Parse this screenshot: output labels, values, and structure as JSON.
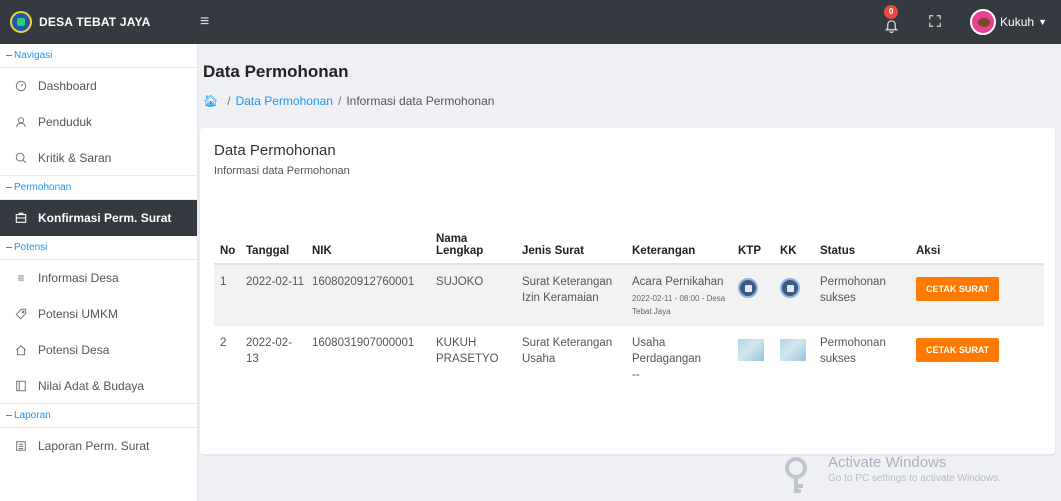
{
  "app": {
    "brand": "DESA TEBAT JAYA",
    "notification_count": "0",
    "user_name": "Kukuh"
  },
  "sidebar": {
    "sections": [
      {
        "header": "Navigasi",
        "items": [
          {
            "label": "Dashboard",
            "icon": "dashboard-icon"
          },
          {
            "label": "Penduduk",
            "icon": "user-icon"
          },
          {
            "label": "Kritik & Saran",
            "icon": "comment-icon"
          }
        ]
      },
      {
        "header": "Permohonan",
        "items": [
          {
            "label": "Konfirmasi Perm. Surat",
            "icon": "inbox-icon",
            "active": true
          }
        ]
      },
      {
        "header": "Potensi",
        "items": [
          {
            "label": "Informasi Desa",
            "icon": "list-icon"
          },
          {
            "label": "Potensi UMKM",
            "icon": "tag-icon"
          },
          {
            "label": "Potensi Desa",
            "icon": "home-icon"
          },
          {
            "label": "Nilai Adat & Budaya",
            "icon": "book-icon"
          }
        ]
      },
      {
        "header": "Laporan",
        "items": [
          {
            "label": "Laporan Perm. Surat",
            "icon": "report-icon"
          }
        ]
      }
    ]
  },
  "page": {
    "title": "Data Permohonan",
    "breadcrumb": {
      "link": "Data Permohonan",
      "sep": "/",
      "current": "Informasi data Permohonan"
    }
  },
  "card": {
    "title": "Data Permohonan",
    "subtitle": "Informasi data Permohonan",
    "columns": [
      "No",
      "Tanggal",
      "NIK",
      "Nama Lengkap",
      "Jenis Surat",
      "Keterangan",
      "KTP",
      "KK",
      "Status",
      "Aksi"
    ],
    "rows": [
      {
        "no": "1",
        "tanggal": "2022-02-11",
        "nik": "1608020912760001",
        "nama": "SUJOKO",
        "jenis": "Surat Keterangan Izin Keramaian",
        "keterangan": "Acara Pernikahan",
        "keterangan_detail": "2022-02-11 - 08:00 - Desa Tebat Jaya",
        "status": "Permohonan sukses",
        "aksi": "CETAK SURAT"
      },
      {
        "no": "2",
        "tanggal": "2022-02-13",
        "nik": "1608031907000001",
        "nama": "KUKUH PRASETYO",
        "jenis": "Surat Keterangan Usaha",
        "keterangan": "Usaha Perdagangan",
        "keterangan_detail": "--",
        "status": "Permohonan sukses",
        "aksi": "CETAK SURAT"
      }
    ]
  },
  "watermark": {
    "title": "Activate Windows",
    "subtitle": "Go to PC settings to activate Windows."
  },
  "colors": {
    "topbar": "#343a40",
    "accent": "#2196f3",
    "button": "#ff7a00"
  }
}
